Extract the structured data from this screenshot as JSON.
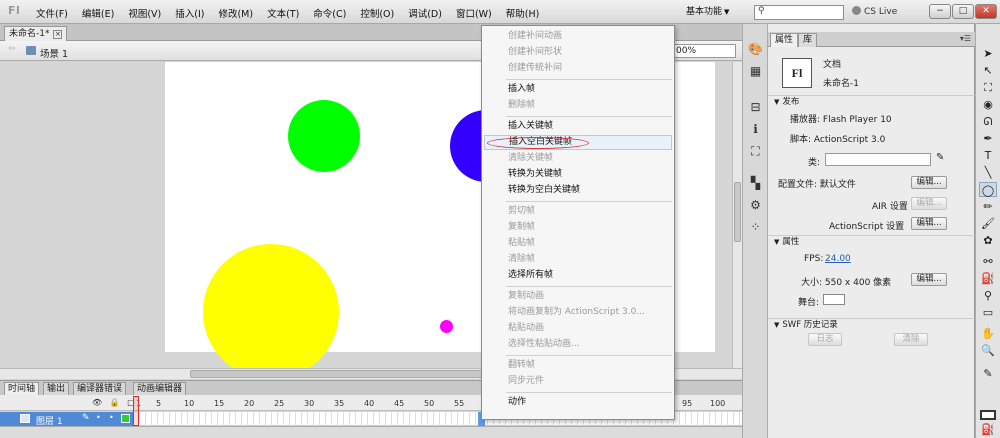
{
  "app": {
    "logo": "Fl",
    "menu": [
      "文件(F)",
      "编辑(E)",
      "视图(V)",
      "插入(I)",
      "修改(M)",
      "文本(T)",
      "命令(C)",
      "控制(O)",
      "调试(D)",
      "窗口(W)",
      "帮助(H)"
    ],
    "workspace": "基本功能",
    "search_placeholder": "",
    "cs_live": "CS Live",
    "window_buttons": [
      "−",
      "□",
      "✕"
    ]
  },
  "document": {
    "tab_label": "未命名-1*",
    "scene_label": "场景 1",
    "zoom": "00%"
  },
  "stage": {
    "background": "#ffffff",
    "circles": [
      {
        "name": "green-circle",
        "color": "#00ff00"
      },
      {
        "name": "blue-circle",
        "color": "#3300ff"
      },
      {
        "name": "yellow-circle",
        "color": "#ffff00"
      },
      {
        "name": "magenta-circle",
        "color": "#ff00ff"
      }
    ]
  },
  "timeline": {
    "tabs": [
      "时间轴",
      "输出",
      "编译器错误",
      "动画编辑器"
    ],
    "frame_numbers": [
      "1",
      "5",
      "10",
      "15",
      "20",
      "25",
      "30",
      "35",
      "40",
      "45",
      "50",
      "55",
      "95",
      "100"
    ],
    "layer_name": "图层 1"
  },
  "context_menu": {
    "items": [
      {
        "label": "创建补间动画",
        "enabled": false
      },
      {
        "label": "创建补间形状",
        "enabled": false
      },
      {
        "label": "创建传统补间",
        "enabled": false
      },
      {
        "sep": true
      },
      {
        "label": "插入帧",
        "enabled": true
      },
      {
        "label": "删除帧",
        "enabled": false
      },
      {
        "sep": true
      },
      {
        "label": "插入关键帧",
        "enabled": true
      },
      {
        "label": "插入空白关键帧",
        "enabled": true,
        "highlight": true
      },
      {
        "label": "清除关键帧",
        "enabled": false
      },
      {
        "label": "转换为关键帧",
        "enabled": true
      },
      {
        "label": "转换为空白关键帧",
        "enabled": true
      },
      {
        "sep": true
      },
      {
        "label": "剪切帧",
        "enabled": false
      },
      {
        "label": "复制帧",
        "enabled": false
      },
      {
        "label": "粘贴帧",
        "enabled": false
      },
      {
        "label": "清除帧",
        "enabled": false
      },
      {
        "label": "选择所有帧",
        "enabled": true
      },
      {
        "sep": true
      },
      {
        "label": "复制动画",
        "enabled": false
      },
      {
        "label": "将动画复制为 ActionScript 3.0...",
        "enabled": false
      },
      {
        "label": "粘贴动画",
        "enabled": false
      },
      {
        "label": "选择性粘贴动画...",
        "enabled": false
      },
      {
        "sep": true
      },
      {
        "label": "翻转帧",
        "enabled": false
      },
      {
        "label": "同步元件",
        "enabled": false
      },
      {
        "sep": true
      },
      {
        "label": "动作",
        "enabled": true
      }
    ]
  },
  "properties": {
    "tabs": [
      "属性",
      "库"
    ],
    "doc_icon": "Fl",
    "doc_type": "文档",
    "doc_name": "未命名-1",
    "publish_header": "发布",
    "player_label": "播放器: Flash Player 10",
    "script_label": "脚本: ActionScript 3.0",
    "class_label": "类:",
    "profile_label": "配置文件: 默认文件",
    "edit_button": "编辑...",
    "air_label": "AIR 设置",
    "as_label": "ActionScript 设置",
    "props_header": "属性",
    "fps_label": "FPS:",
    "fps_value": "24.00",
    "size_label": "大小: 550 x 400 像素",
    "stage_label": "舞台:",
    "swf_header": "SWF 历史记录",
    "log_button": "日志",
    "clear_button": "清除"
  },
  "colors": {
    "fill_swatch": "#ff00ff",
    "layer_highlight": "#4e8ad6"
  }
}
